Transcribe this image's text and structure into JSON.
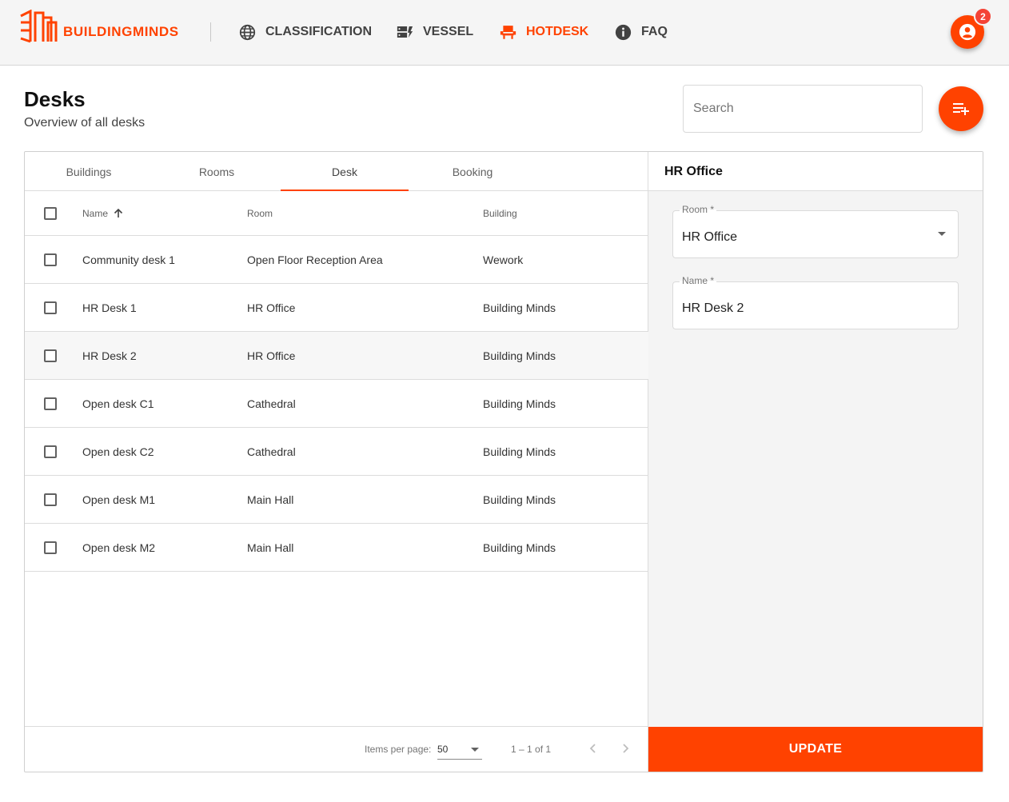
{
  "header": {
    "brand": "BUILDINGMINDS",
    "nav": [
      {
        "label": "CLASSIFICATION",
        "icon": "globe-icon",
        "active": false
      },
      {
        "label": "VESSEL",
        "icon": "vessel-icon",
        "active": false
      },
      {
        "label": "HOTDESK",
        "icon": "desk-chair-icon",
        "active": true
      },
      {
        "label": "FAQ",
        "icon": "info-icon",
        "active": false
      }
    ],
    "notification_count": "2",
    "accent_color": "#ff4200"
  },
  "page": {
    "title": "Desks",
    "subtitle": "Overview of all desks",
    "search_placeholder": "Search"
  },
  "tabs": [
    "Buildings",
    "Rooms",
    "Desk",
    "Booking"
  ],
  "active_tab": "Desk",
  "table": {
    "columns": [
      "Name",
      "Room",
      "Building"
    ],
    "sort": {
      "column": "Name",
      "direction": "ascending"
    },
    "rows": [
      {
        "name": "Community desk 1",
        "room": "Open Floor Reception Area",
        "building": "Wework"
      },
      {
        "name": "HR Desk 1",
        "room": "HR Office",
        "building": "Building Minds"
      },
      {
        "name": "HR Desk 2",
        "room": "HR Office",
        "building": "Building Minds"
      },
      {
        "name": "Open desk C1",
        "room": "Cathedral",
        "building": "Building Minds"
      },
      {
        "name": "Open desk C2",
        "room": "Cathedral",
        "building": "Building Minds"
      },
      {
        "name": "Open desk M1",
        "room": "Main Hall",
        "building": "Building Minds"
      },
      {
        "name": "Open desk M2",
        "room": "Main Hall",
        "building": "Building Minds"
      }
    ],
    "selected_row": "HR Desk 2"
  },
  "paginator": {
    "items_per_page_label": "Items per page:",
    "items_per_page": "50",
    "range": "1 – 1 of 1"
  },
  "detail": {
    "title": "HR Office",
    "room_label": "Room *",
    "room_value": "HR Office",
    "name_label": "Name *",
    "name_value": "HR Desk 2",
    "update_label": "UPDATE"
  }
}
